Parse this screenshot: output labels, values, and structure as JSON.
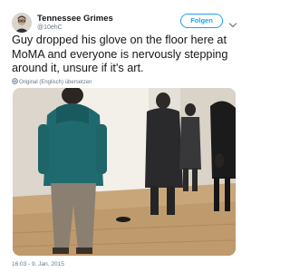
{
  "author": {
    "name": "Tennessee Grimes",
    "handle": "@10ehC"
  },
  "follow_label": "Folgen",
  "tweet_lines": [
    "Guy dropped his glove on the floor here at",
    "MoMA and everyone is nervously stepping",
    "around it, unsure if it's art."
  ],
  "translate_label": "Original (Englisch) übersetzen",
  "timestamp": "16:03 - 9. Jan. 2015",
  "icons": {
    "more": "chevron-down-icon",
    "translate": "globe-icon"
  },
  "colors": {
    "accent": "#1da1f2",
    "text": "#14171a",
    "secondary": "#657786"
  }
}
